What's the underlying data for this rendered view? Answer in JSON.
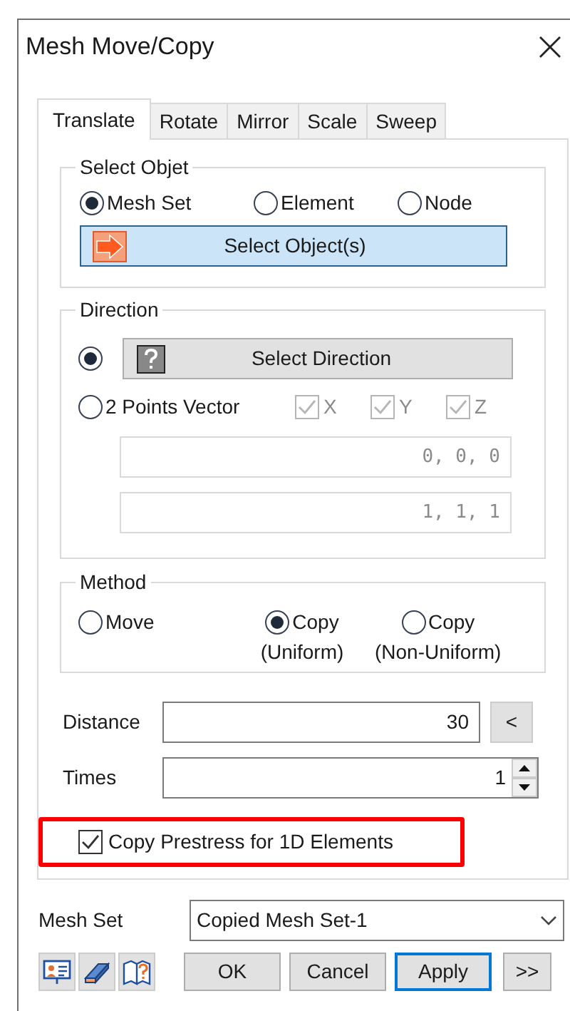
{
  "window": {
    "title": "Mesh Move/Copy"
  },
  "tabs": [
    {
      "label": "Translate",
      "selected": true
    },
    {
      "label": "Rotate",
      "selected": false
    },
    {
      "label": "Mirror",
      "selected": false
    },
    {
      "label": "Scale",
      "selected": false
    },
    {
      "label": "Sweep",
      "selected": false
    }
  ],
  "select_object": {
    "title": "Select Objet",
    "options": [
      {
        "label": "Mesh Set",
        "selected": true
      },
      {
        "label": "Element",
        "selected": false
      },
      {
        "label": "Node",
        "selected": false
      }
    ],
    "button": "Select Object(s)"
  },
  "direction": {
    "title": "Direction",
    "options": [
      {
        "kind": "button",
        "label": "Select Direction",
        "selected": true
      },
      {
        "kind": "label",
        "label": "2 Points Vector",
        "selected": false
      }
    ],
    "axes": [
      {
        "label": "X",
        "checked": true,
        "disabled": true
      },
      {
        "label": "Y",
        "checked": true,
        "disabled": true
      },
      {
        "label": "Z",
        "checked": true,
        "disabled": true
      }
    ],
    "point_fields": [
      {
        "value": "0, 0, 0",
        "disabled": true
      },
      {
        "value": "1, 1, 1",
        "disabled": true
      }
    ]
  },
  "method": {
    "title": "Method",
    "options": [
      {
        "label": "Move",
        "selected": false
      },
      {
        "label": "Copy",
        "sublabel": "(Uniform)",
        "selected": true
      },
      {
        "label": "Copy",
        "sublabel": "(Non-Uniform)",
        "selected": false
      }
    ]
  },
  "distance": {
    "label": "Distance",
    "value": "30",
    "pick_button": "<"
  },
  "times": {
    "label": "Times",
    "value": "1"
  },
  "copy_prestress": {
    "label": "Copy Prestress for 1D Elements",
    "checked": true,
    "highlighted": true
  },
  "mesh_set": {
    "label": "Mesh Set",
    "value": "Copied Mesh Set-1"
  },
  "buttons": [
    {
      "label": "OK",
      "focused": false
    },
    {
      "label": "Cancel",
      "focused": false
    },
    {
      "label": "Apply",
      "focused": true
    },
    {
      "label": ">>",
      "focused": false
    }
  ]
}
